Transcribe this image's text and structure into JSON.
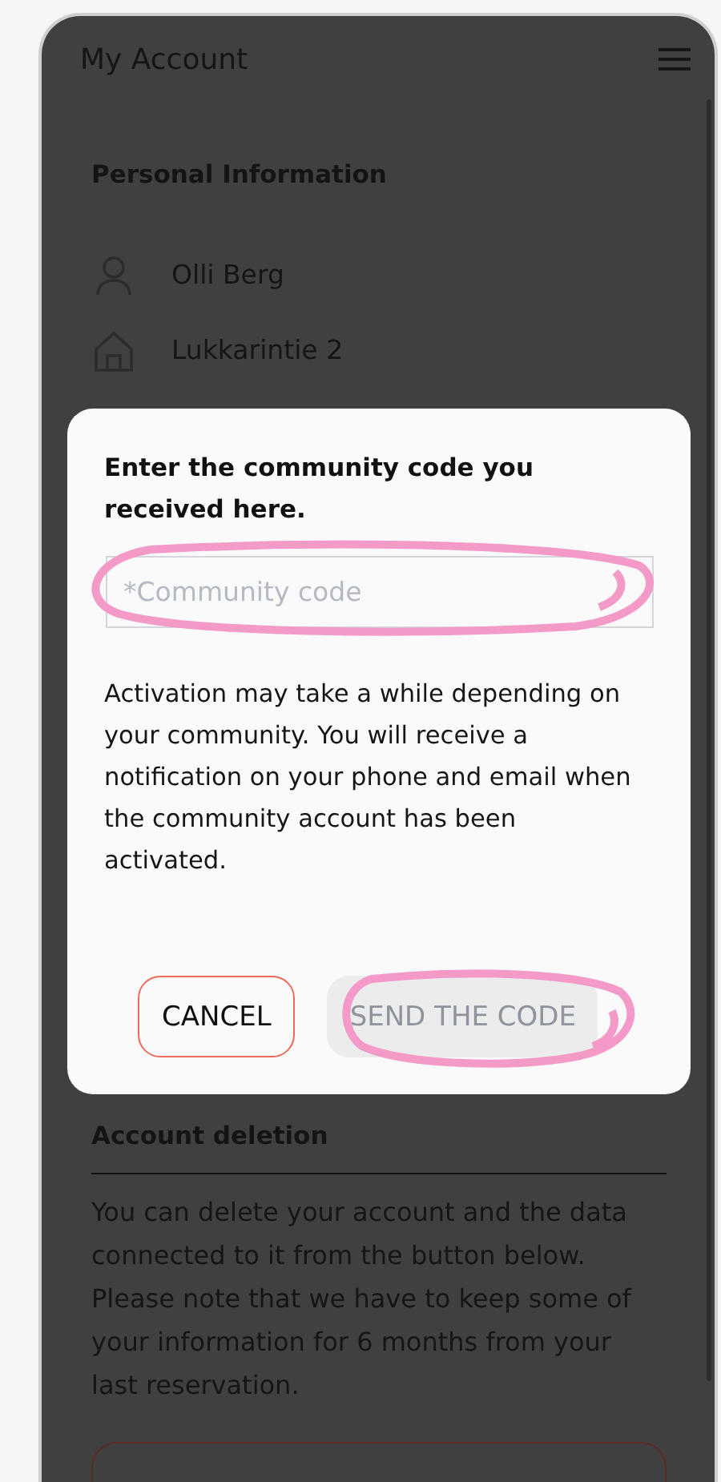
{
  "header": {
    "title": "My Account"
  },
  "personal_information": {
    "heading": "Personal Information",
    "rows": [
      {
        "kind": "person",
        "text": "Olli Berg"
      },
      {
        "kind": "home",
        "text": "Lukkarintie 2"
      }
    ]
  },
  "dialog": {
    "title": "Enter the community code you received here.",
    "code_field": {
      "placeholder": "*Community code"
    },
    "message": "Activation may take a while depending on your community. You will receive a notification on your phone and email when the community account has been activated.",
    "buttons": [
      {
        "kind": "outline",
        "label": "CANCEL",
        "disabled": false
      },
      {
        "kind": "filled",
        "label": "SEND THE CODE",
        "disabled": true
      }
    ]
  },
  "account_deletion": {
    "heading": "Account deletion",
    "text": "You can delete your account and the data connected to it from the button below. Please note that we have to keep some of your information for 6 months from your last reservation."
  }
}
